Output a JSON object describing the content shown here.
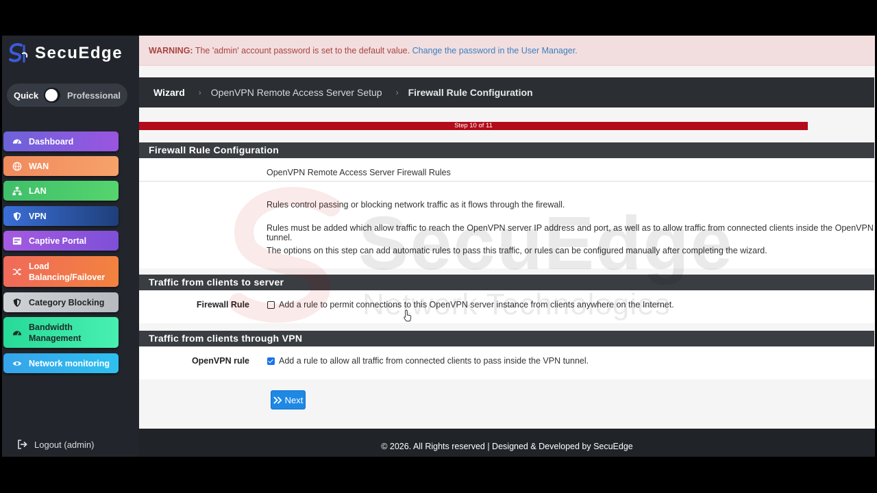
{
  "brand": {
    "name": "SecuEdge"
  },
  "mode": {
    "left_label": "Quick",
    "right_label": "Professional"
  },
  "sidebar": {
    "items": [
      {
        "label": "Dashboard",
        "icon": "dashboard-icon"
      },
      {
        "label": "WAN",
        "icon": "globe-icon"
      },
      {
        "label": "LAN",
        "icon": "network-icon"
      },
      {
        "label": "VPN",
        "icon": "shield-icon"
      },
      {
        "label": "Captive Portal",
        "icon": "portal-icon"
      },
      {
        "label": "Load Balancing/Failover",
        "icon": "shuffle-icon"
      },
      {
        "label": "Category Blocking",
        "icon": "shield-icon"
      },
      {
        "label": "Bandwidth Management",
        "icon": "gauge-icon"
      },
      {
        "label": "Network monitoring",
        "icon": "eye-icon"
      }
    ],
    "logout": "Logout (admin)"
  },
  "warning": {
    "prefix": "WARNING:",
    "message": " The 'admin' account password is set to the default value. ",
    "link": "Change the password in the User Manager."
  },
  "breadcrumb": [
    "Wizard",
    "OpenVPN Remote Access Server Setup",
    "Firewall Rule Configuration"
  ],
  "progress": {
    "label": "Step 10 of 11",
    "step": 10,
    "total": 11
  },
  "section1": {
    "title": "Firewall Rule Configuration",
    "subtitle": "OpenVPN Remote Access Server Firewall Rules",
    "paragraphs": [
      "Rules control passing or blocking network traffic as it flows through the firewall.",
      "Rules must be added which allow traffic to reach the OpenVPN server IP address and port, as well as to allow traffic from connected clients inside the OpenVPN tunnel.",
      "The options on this step can add automatic rules to pass this traffic, or rules can be configured manually after completing the wizard."
    ]
  },
  "section2": {
    "title": "Traffic from clients to server",
    "label": "Firewall Rule",
    "checked": false,
    "text": "Add a rule to permit connections to this OpenVPN server instance from clients anywhere on the Internet."
  },
  "section3": {
    "title": "Traffic from clients through VPN",
    "label": "OpenVPN rule",
    "checked": true,
    "text": "Add a rule to allow all traffic from connected clients to pass inside the VPN tunnel."
  },
  "next_button": "Next",
  "footer": "© 2026. All Rights reserved | Designed & Developed by SecuEdge",
  "watermark": {
    "title": "SecuEdge",
    "subtitle": "Network Technologies"
  },
  "colors": {
    "sidebar_bg": "#22262c",
    "warning_bg": "#f2dede",
    "progress": "#b30c1b",
    "primary_button": "#1e88e5"
  }
}
